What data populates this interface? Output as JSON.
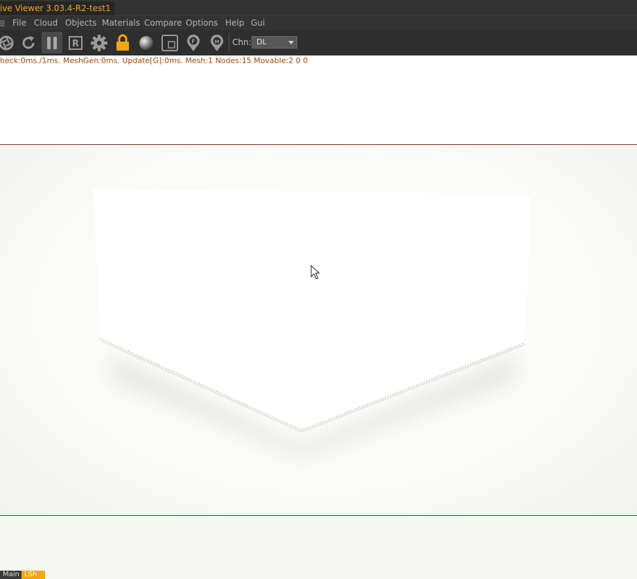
{
  "window": {
    "title": "ive Viewer 3.03.4-R2-test1"
  },
  "menu": {
    "items": [
      "File",
      "Cloud",
      "Objects",
      "Materials",
      "Compare",
      "Options",
      "Help",
      "Gui"
    ]
  },
  "toolbar": {
    "icons": [
      "aperture-icon",
      "refresh-icon",
      "pause-icon",
      "render-region-icon",
      "settings-gear-icon",
      "lock-icon",
      "material-sphere-icon",
      "viewport-frame-icon",
      "focus-pin-icon",
      "material-pin-icon"
    ],
    "channel_label": "Chn:",
    "channel_value": "DL",
    "colors": {
      "accent": "#f2a516",
      "toolbar_bg": "#2e2e2e",
      "icon": "#9a9a9a"
    }
  },
  "viewport": {
    "stats": "heck:0ms./1ms. MeshGen:0ms. Update[G]:0ms. Mesh:1 Nodes:15 Movable:2  0 0",
    "guide_color": "#8b2a1a"
  },
  "status": {
    "tabs": [
      "Main",
      "LSh"
    ]
  }
}
